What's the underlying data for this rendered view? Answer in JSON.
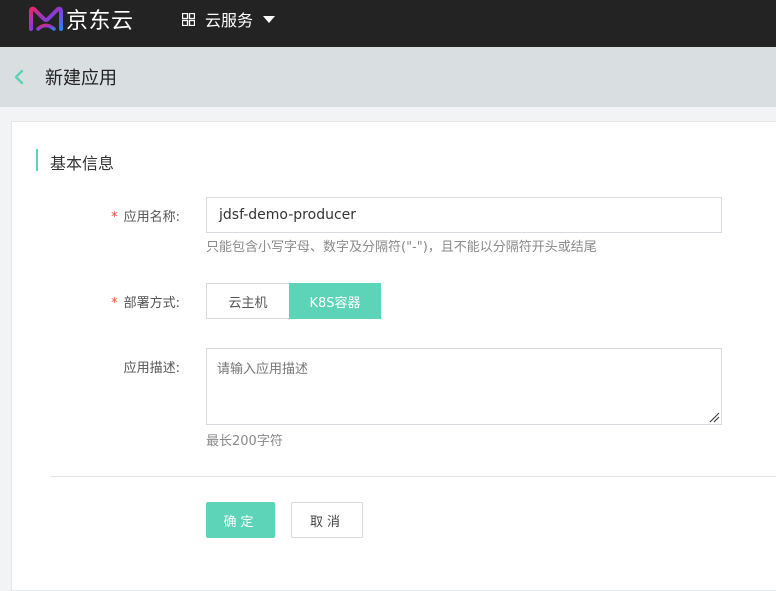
{
  "topbar": {
    "logo_text": "京东云",
    "services_label": "云服务",
    "icons": {
      "logo": "jdcloud-logo-icon",
      "grid": "grid-icon",
      "caret": "caret-down-icon"
    }
  },
  "subheader": {
    "title": "新建应用",
    "back_icon": "chevron-left-icon"
  },
  "section": {
    "title": "基本信息"
  },
  "form": {
    "name": {
      "required_mark": "*",
      "label": "应用名称:",
      "value": "jdsf-demo-producer",
      "hint": "只能包含小写字母、数字及分隔符(\"-\")，且不能以分隔符开头或结尾"
    },
    "deploy": {
      "required_mark": "*",
      "label": "部署方式:",
      "options": [
        "云主机",
        "K8S容器"
      ],
      "selected": "K8S容器"
    },
    "description": {
      "label": "应用描述:",
      "placeholder": "请输入应用描述",
      "hint": "最长200字符"
    }
  },
  "actions": {
    "ok_label": "确定",
    "cancel_label": "取消"
  },
  "colors": {
    "accent": "#5dd3b7",
    "topbar": "#232323",
    "subheader": "#d9dee1",
    "required": "#e84e3c"
  }
}
